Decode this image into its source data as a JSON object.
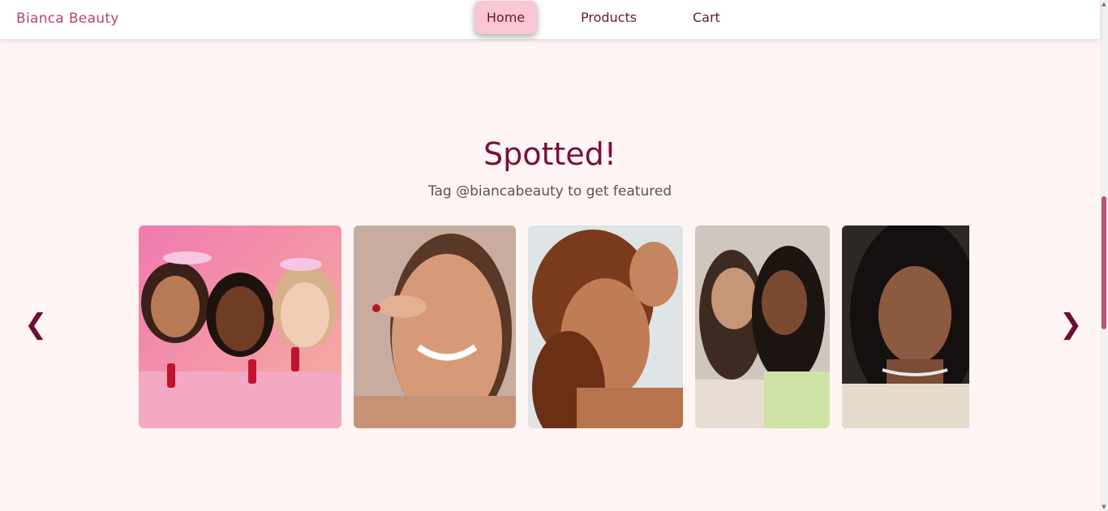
{
  "brand": "Bianca Beauty",
  "nav": {
    "home": "Home",
    "products": "Products",
    "cart": "Cart",
    "active": "Home"
  },
  "section": {
    "title": "Spotted!",
    "subtitle": "Tag @biancabeauty to get featured"
  },
  "carousel": {
    "prev_icon": "chevron-left-icon",
    "next_icon": "chevron-right-icon",
    "prev_glyph": "❮",
    "next_glyph": "❯"
  },
  "colors": {
    "background": "#fff5f5",
    "accent": "#7a0f3b",
    "brand": "#b5476b",
    "active_nav": "#f8c7d3"
  }
}
